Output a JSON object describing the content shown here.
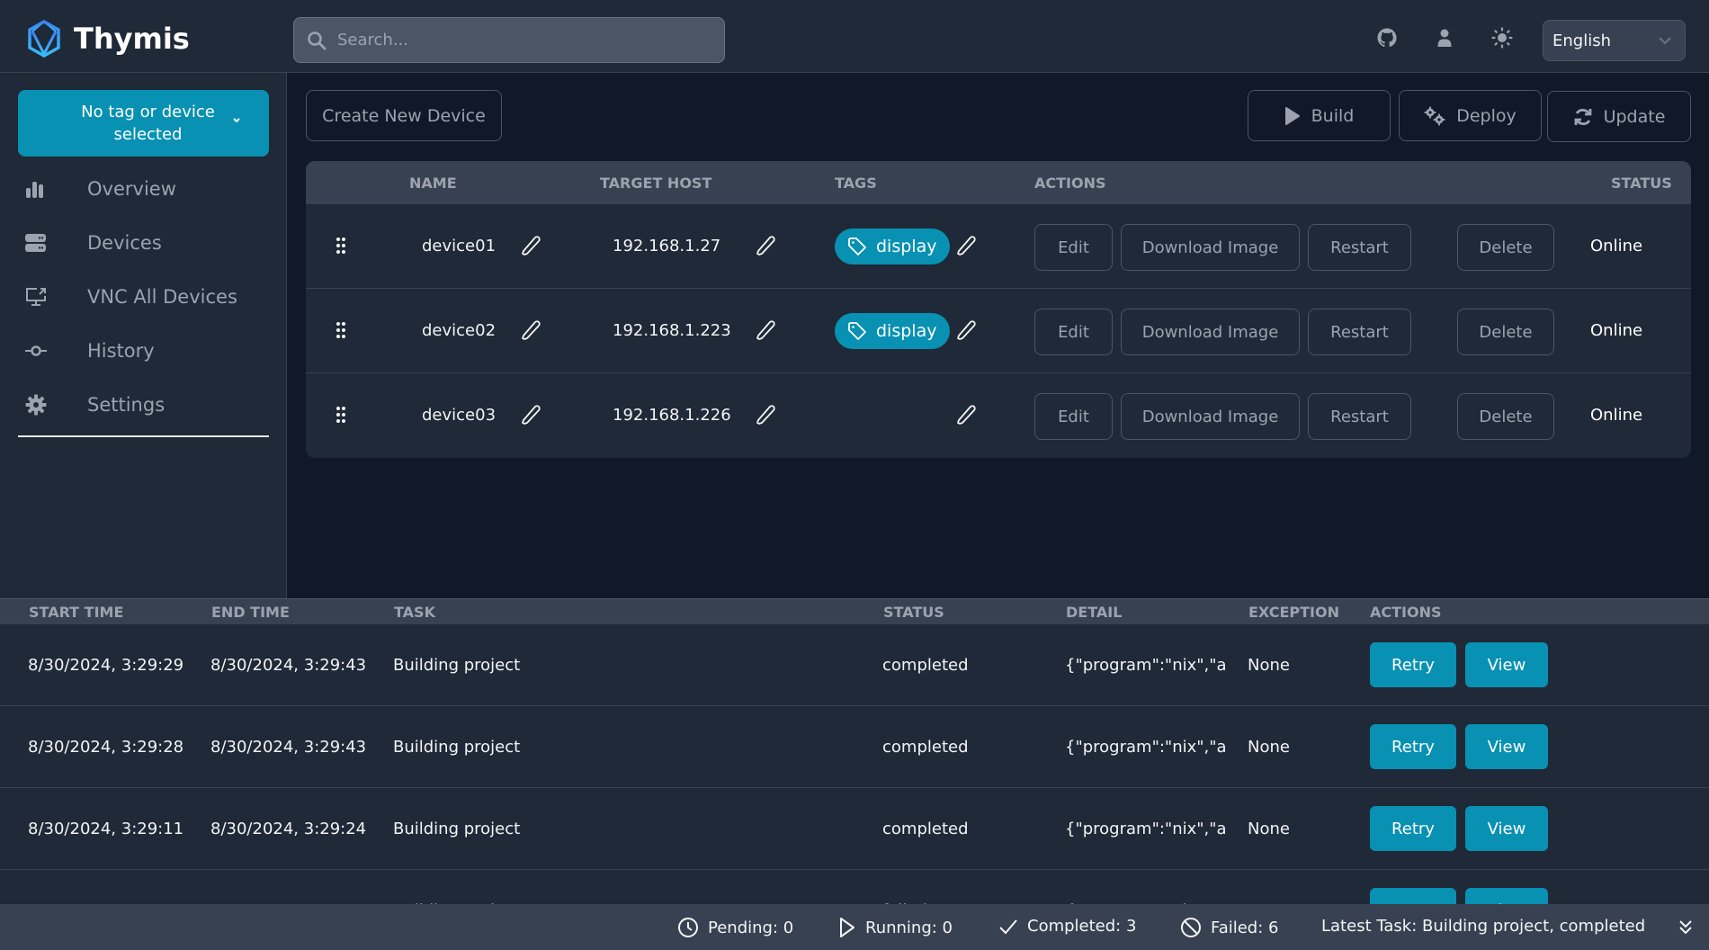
{
  "app": {
    "title": "Thymis",
    "brand_color": "#0891b2"
  },
  "header": {
    "search_placeholder": "Search...",
    "search_value": "",
    "icons": [
      "github-icon",
      "user-icon",
      "theme-toggle-icon"
    ],
    "language": "English"
  },
  "sidebar": {
    "selector_label": "No tag or device selected",
    "items": [
      {
        "label": "Overview",
        "icon": "chart-bar-icon"
      },
      {
        "label": "Devices",
        "icon": "server-icon"
      },
      {
        "label": "VNC All Devices",
        "icon": "screen-share-icon"
      },
      {
        "label": "History",
        "icon": "commit-icon"
      },
      {
        "label": "Settings",
        "icon": "gear-icon"
      }
    ]
  },
  "toolbar": {
    "create_label": "Create New Device",
    "build_label": "Build",
    "deploy_label": "Deploy",
    "update_label": "Update"
  },
  "devices": {
    "columns": [
      "NAME",
      "TARGET HOST",
      "TAGS",
      "ACTIONS",
      "STATUS"
    ],
    "action_labels": {
      "edit": "Edit",
      "download": "Download Image",
      "restart": "Restart",
      "delete": "Delete"
    },
    "rows": [
      {
        "name": "device01",
        "host": "192.168.1.27",
        "tags": [
          "display"
        ],
        "status": "Online"
      },
      {
        "name": "device02",
        "host": "192.168.1.223",
        "tags": [
          "display"
        ],
        "status": "Online"
      },
      {
        "name": "device03",
        "host": "192.168.1.226",
        "tags": [],
        "status": "Online"
      }
    ]
  },
  "tasks": {
    "columns": [
      "START TIME",
      "END TIME",
      "TASK",
      "STATUS",
      "DETAIL",
      "EXCEPTION",
      "ACTIONS"
    ],
    "retry_label": "Retry",
    "view_label": "View",
    "rows": [
      {
        "start": "8/30/2024, 3:29:29",
        "end": "8/30/2024, 3:29:43",
        "task": "Building project",
        "status": "completed",
        "detail": "{\"program\":\"nix\",\"a",
        "exception": "None"
      },
      {
        "start": "8/30/2024, 3:29:28",
        "end": "8/30/2024, 3:29:43",
        "task": "Building project",
        "status": "completed",
        "detail": "{\"program\":\"nix\",\"a",
        "exception": "None"
      },
      {
        "start": "8/30/2024, 3:29:11",
        "end": "8/30/2024, 3:29:24",
        "task": "Building project",
        "status": "completed",
        "detail": "{\"program\":\"nix\",\"a",
        "exception": "None"
      },
      {
        "start": "",
        "end": "",
        "task": "Building project",
        "status": "failed",
        "detail": "{\"program\":\"nix\",\"a",
        "exception": ""
      }
    ]
  },
  "statusbar": {
    "pending": "Pending: 0",
    "running": "Running: 0",
    "completed": "Completed: 3",
    "failed": "Failed: 6",
    "latest": "Latest Task: Building project, completed"
  }
}
